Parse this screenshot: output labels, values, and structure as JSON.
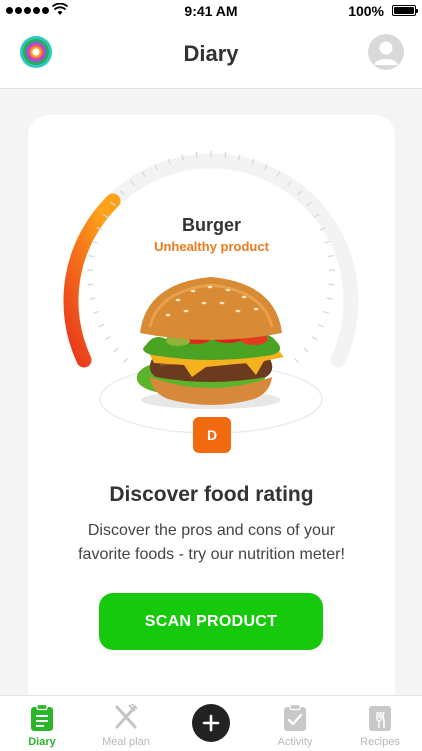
{
  "status_bar": {
    "time": "9:41 AM",
    "battery": "100%"
  },
  "header": {
    "title": "Diary"
  },
  "meter": {
    "food_name": "Burger",
    "status": "Unhealthy product",
    "grade": "D",
    "colors": {
      "gradient_start": "#e8341c",
      "gradient_end": "#ffa21a",
      "track": "#f3f3f3",
      "ticks": "#d6d6d6"
    }
  },
  "card": {
    "heading": "Discover food rating",
    "description_line1": "Discover the pros and cons of your",
    "description_line2": "favorite foods - try our nutrition meter!",
    "button_label": "SCAN PRODUCT"
  },
  "tabs": [
    {
      "label": "Diary",
      "icon": "clipboard-icon",
      "active": true
    },
    {
      "label": "Meal plan",
      "icon": "fork-knife-icon",
      "active": false
    },
    {
      "label": "Activity",
      "icon": "check-calendar-icon",
      "active": false
    },
    {
      "label": "Recipes",
      "icon": "book-icon",
      "active": false
    }
  ],
  "colors": {
    "accent": "#16c90c",
    "tab_active": "#2bb52a",
    "warning": "#f07a1a",
    "grade_badge": "#f26a10"
  }
}
